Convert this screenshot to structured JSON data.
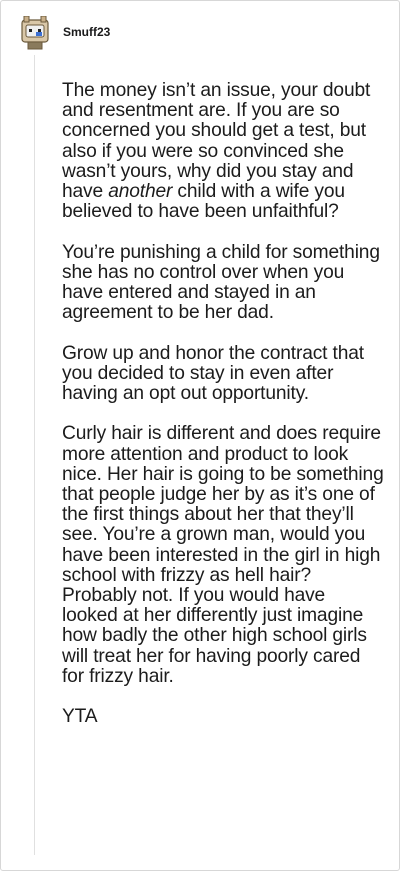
{
  "comment": {
    "username": "Smuff23",
    "avatar_icon": "snoo-avatar-icon",
    "paragraphs": {
      "p1": {
        "before": "The money isn’t an issue, your doubt and resentment are. If you are so concerned you should get a test, but also if you were so convinced she wasn’t yours, why did you stay and have ",
        "emphasis": "another",
        "after": " child with a wife you believed to have been unfaithful?"
      },
      "p2": "You’re punishing a child for something she has no control over when you have entered and stayed in an agreement to be her dad.",
      "p3": "Grow up and honor the contract that you decided to stay in even after having an opt out opportunity.",
      "p4": "Curly hair is different and does require more attention and product to look nice. Her hair is going to be something that people judge her by as it’s one of the first things about her that they’ll see. You’re a grown man, would you have been interested in the girl in high school with frizzy as hell hair? Probably not. If you would have looked at her differently just imagine how badly the other high school girls will treat her for having poorly cared for frizzy hair.",
      "p5": "YTA"
    }
  },
  "colors": {
    "text": "#1c1c1c",
    "thread_line": "#e0e0e0",
    "border": "#d7d7d7",
    "avatar_bg": "#d9c7a8",
    "avatar_face": "#f0f0f0",
    "avatar_accent": "#3b6fd4"
  }
}
